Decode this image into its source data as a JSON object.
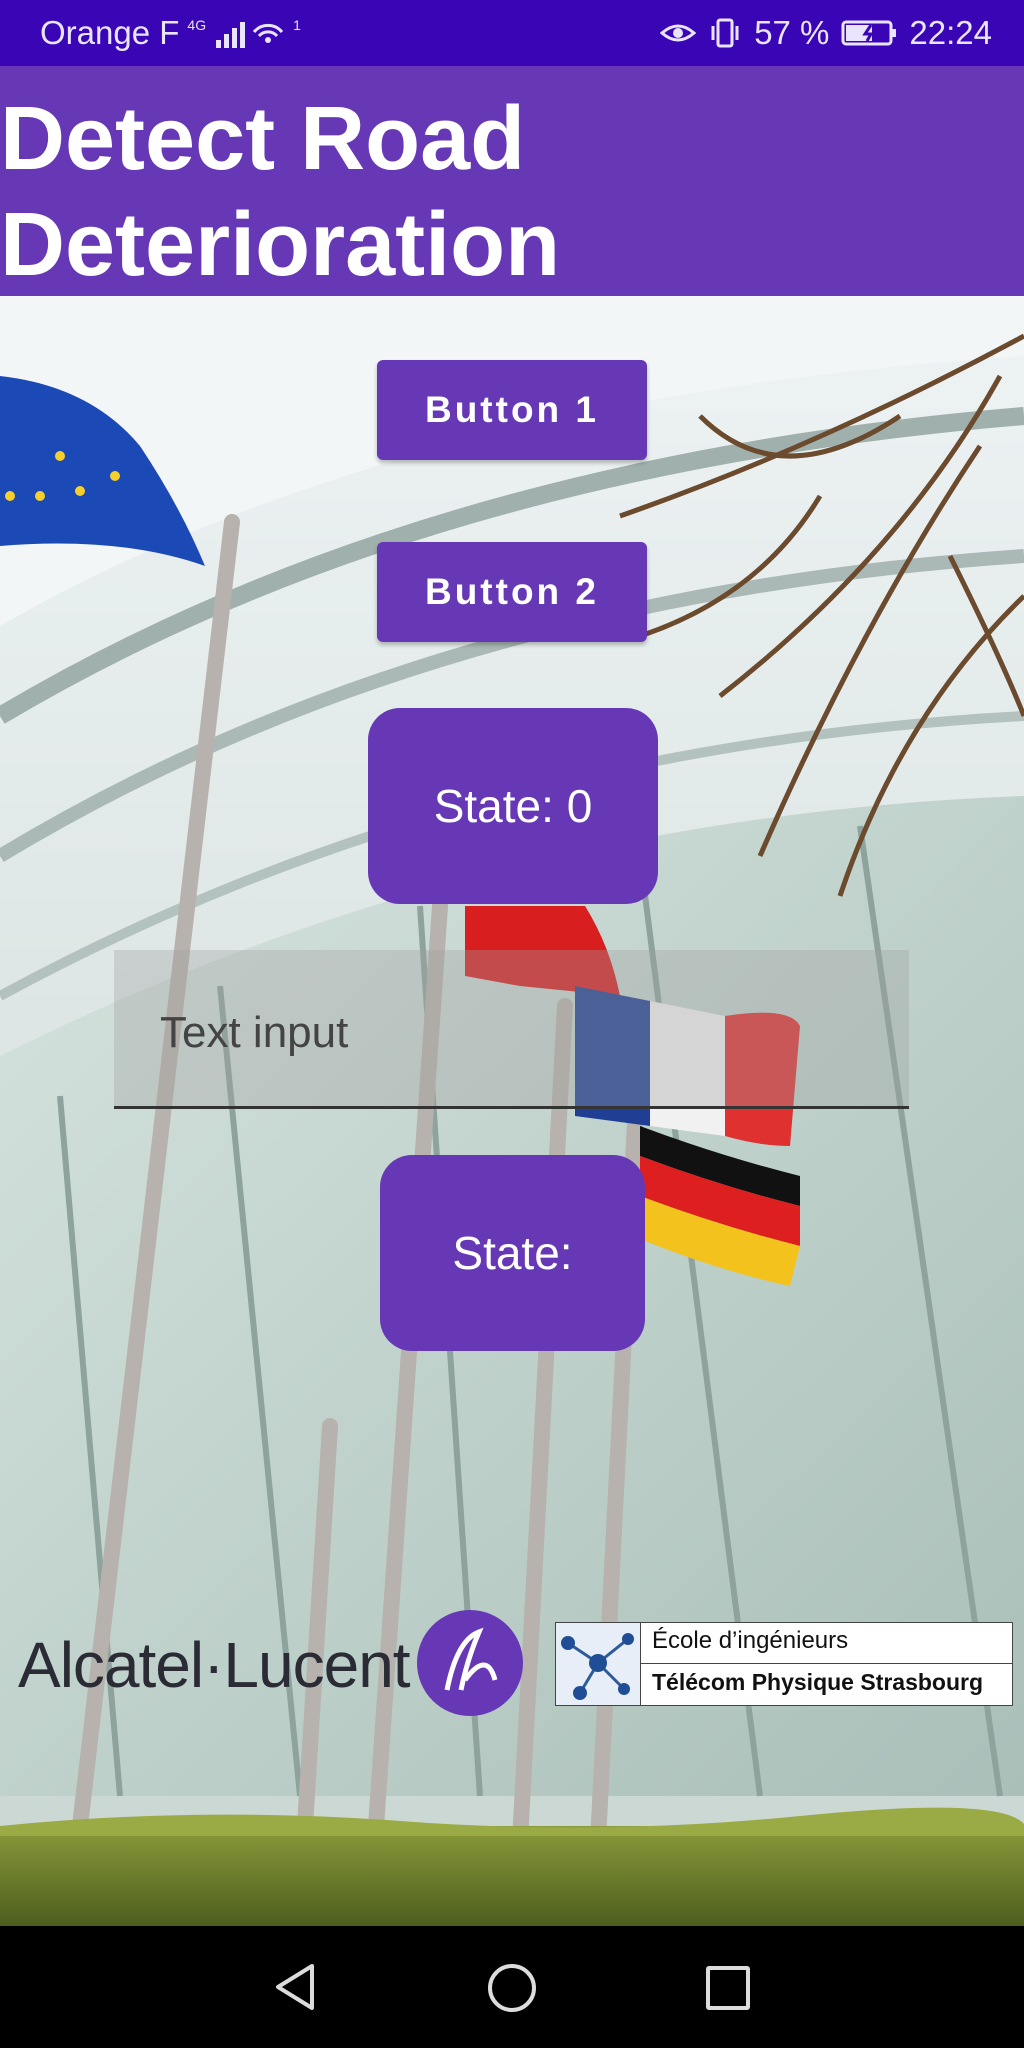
{
  "status_bar": {
    "carrier": "Orange F",
    "network_type": "4G",
    "wifi_badge": "1",
    "battery": "57 %",
    "time": "22:24"
  },
  "app": {
    "title_line1": "Detect Road",
    "title_line2": "Deterioration"
  },
  "controls": {
    "button1_label": "Button 1",
    "button2_label": "Button 2",
    "state_top": "State: 0",
    "text_input_placeholder": "Text input",
    "state_bottom": "State:"
  },
  "logos": {
    "alcatel": "Alcatel·Lucent",
    "tps_line1": "École d’ingénieurs",
    "tps_line2": "Télécom Physique Strasbourg"
  },
  "colors": {
    "status_bar": "#3a05b5",
    "primary": "#6638b6",
    "nav_bar": "#000000"
  },
  "icons": {
    "signal": "signal-icon",
    "wifi": "wifi-icon",
    "eye_comfort": "eye-icon",
    "vibrate": "vibrate-icon",
    "battery": "battery-charging-icon",
    "nav_back": "back-triangle-icon",
    "nav_home": "home-circle-icon",
    "nav_recents": "recents-square-icon"
  }
}
